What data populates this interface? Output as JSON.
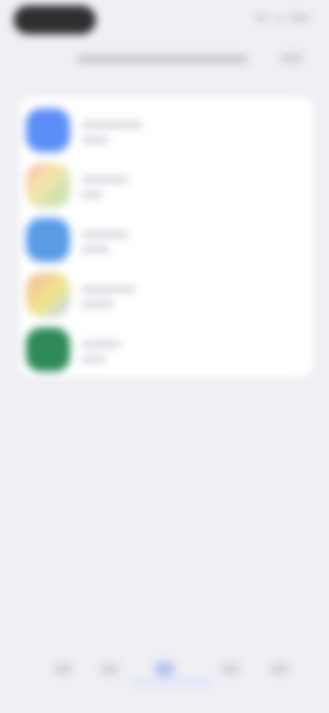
{
  "status_bar": {
    "time": "",
    "icons": [
      "signal-icon",
      "wifi-icon",
      "battery-icon"
    ]
  },
  "header": {
    "title": "",
    "action_label": ""
  },
  "list": {
    "items": [
      {
        "icon": "app-icon",
        "icon_color": "#5b8ff7",
        "title": "",
        "subtitle": ""
      },
      {
        "icon": "app-icon",
        "icon_color": "#f4c7c7",
        "title": "",
        "subtitle": ""
      },
      {
        "icon": "app-icon",
        "icon_color": "#5a9be8",
        "title": "",
        "subtitle": ""
      },
      {
        "icon": "app-icon",
        "icon_color": "#e9d88a",
        "title": "",
        "subtitle": ""
      },
      {
        "icon": "app-icon",
        "icon_color": "#2e8a57",
        "title": "",
        "subtitle": ""
      }
    ]
  },
  "tab_bar": {
    "tabs": [
      {
        "label": "",
        "icon": "tab-icon-1"
      },
      {
        "label": "",
        "icon": "tab-icon-2"
      },
      {
        "label": "",
        "icon": "tab-icon-3",
        "active": true
      },
      {
        "label": "",
        "icon": "tab-icon-4"
      },
      {
        "label": "",
        "icon": "tab-icon-5"
      }
    ]
  }
}
